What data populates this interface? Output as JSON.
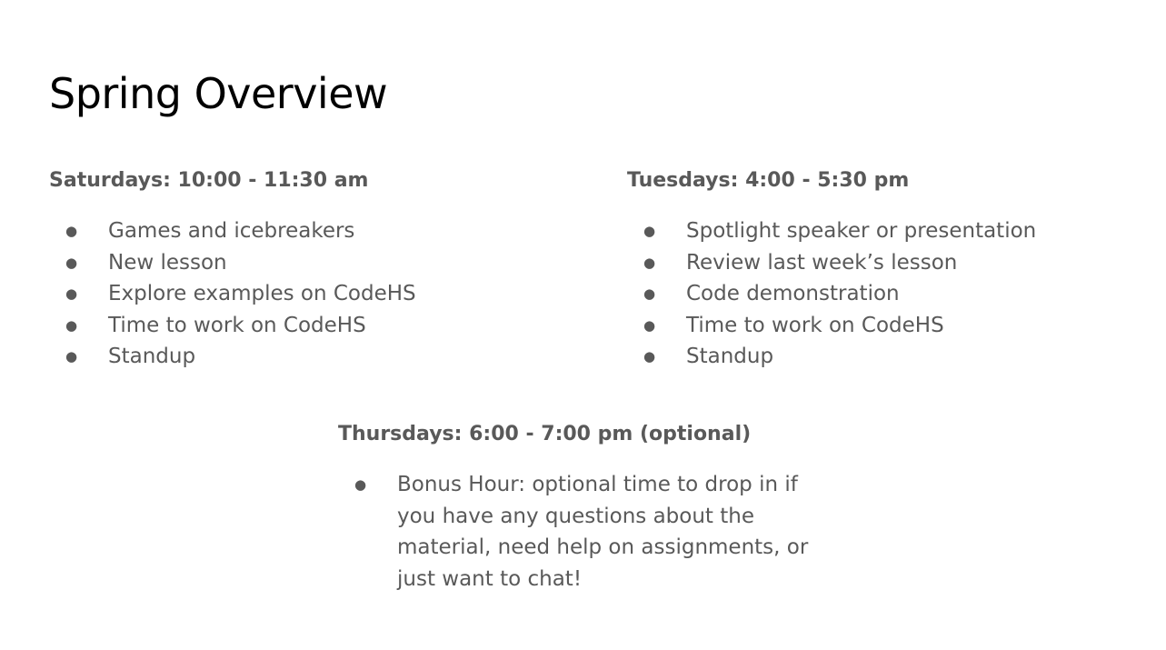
{
  "slide": {
    "title": "Spring Overview",
    "sections": {
      "saturdays": {
        "heading": "Saturdays: 10:00 - 11:30 am",
        "items": [
          "Games and icebreakers",
          "New lesson",
          "Explore examples on CodeHS",
          "Time to work on CodeHS",
          "Standup"
        ]
      },
      "tuesdays": {
        "heading": "Tuesdays: 4:00 - 5:30 pm",
        "items": [
          "Spotlight speaker or presentation",
          "Review last week’s lesson",
          "Code demonstration",
          "Time to work on CodeHS",
          "Standup"
        ]
      },
      "thursdays": {
        "heading": "Thursdays: 6:00 - 7:00 pm (optional)",
        "items": [
          "Bonus Hour: optional time to drop in if you have any questions about the material, need help on assignments, or just want to chat!"
        ]
      }
    },
    "bullet_glyph": "●",
    "colors": {
      "title": "#000000",
      "body": "#595959",
      "background": "#ffffff"
    }
  }
}
